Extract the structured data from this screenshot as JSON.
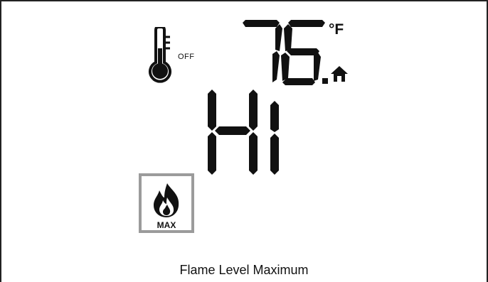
{
  "display": {
    "thermostat_status": "OFF",
    "temperature": "76",
    "temperature_unit": "°F",
    "mode_text": "Hi",
    "flame_badge_label": "MAX",
    "caption": "Flame Level Maximum"
  },
  "icons": {
    "thermometer": "thermometer-icon",
    "home": "home-icon",
    "flame": "flame-icon"
  },
  "colors": {
    "segment": "#111111",
    "badge_border": "#9b9b9b"
  }
}
